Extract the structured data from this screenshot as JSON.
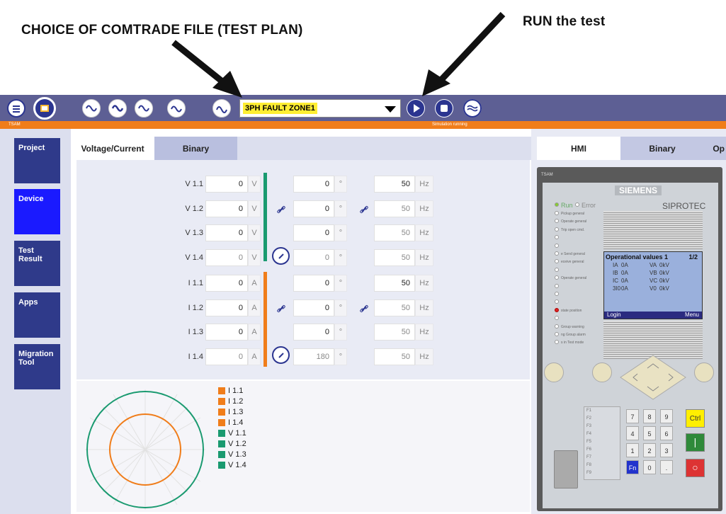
{
  "annotations": {
    "comtrade_note": "CHOICE OF COMTRADE FILE (TEST PLAN)",
    "run_note": "RUN the test"
  },
  "toolbar": {
    "app_label": "TSAM",
    "status": "Simulation running",
    "test_plan_selected": "3PH FAULT ZONE1"
  },
  "nav": [
    "Project",
    "Device",
    "Test Result",
    "Apps",
    "Migration Tool"
  ],
  "tabs": {
    "voltage_current": "Voltage/Current",
    "binary": "Binary"
  },
  "right_tabs": {
    "hmi": "HMI",
    "binary": "Binary",
    "op": "Op"
  },
  "rows": [
    {
      "label": "V 1.1",
      "mag": "0",
      "unit": "V",
      "angle": "0",
      "freq": "50",
      "fu": "Hz"
    },
    {
      "label": "V 1.2",
      "mag": "0",
      "unit": "V",
      "angle": "0",
      "freq": "50",
      "fu": "Hz"
    },
    {
      "label": "V 1.3",
      "mag": "0",
      "unit": "V",
      "angle": "0",
      "freq": "50",
      "fu": "Hz"
    },
    {
      "label": "V 1.4",
      "mag": "0",
      "unit": "V",
      "angle": "0",
      "freq": "50",
      "fu": "Hz"
    },
    {
      "label": "I 1.1",
      "mag": "0",
      "unit": "A",
      "angle": "0",
      "freq": "50",
      "fu": "Hz"
    },
    {
      "label": "I 1.2",
      "mag": "0",
      "unit": "A",
      "angle": "0",
      "freq": "50",
      "fu": "Hz"
    },
    {
      "label": "I 1.3",
      "mag": "0",
      "unit": "A",
      "angle": "0",
      "freq": "50",
      "fu": "Hz"
    },
    {
      "label": "I 1.4",
      "mag": "0",
      "unit": "A",
      "angle": "180",
      "freq": "50",
      "fu": "Hz"
    }
  ],
  "deg": "°",
  "legend": [
    "I 1.1",
    "I 1.2",
    "I 1.3",
    "I 1.4",
    "V 1.1",
    "V 1.2",
    "V 1.3",
    "V 1.4"
  ],
  "colors": {
    "voltage": "#1a9a70",
    "current": "#f07d1a",
    "topbar": "#5d5f94",
    "nav": "#2f3a8a"
  },
  "device": {
    "small_label": "TSAM",
    "brand": "SIEMENS",
    "model": "SIPROTEC",
    "run": "Run",
    "error": "Error",
    "leds": [
      "Pickup general",
      "Operate general",
      "Trip open cmd.",
      "",
      "",
      "e Send general",
      "eceive general",
      "",
      "Operate general",
      "",
      "",
      "",
      "state position",
      "",
      "Group warning",
      "ng Group alarm",
      "s in Test mode"
    ],
    "screen_title": "Operational values 1",
    "screen_page": "1/2",
    "screen_lines": [
      [
        "IA",
        "0A",
        "VA",
        "0kV"
      ],
      [
        "IB",
        "0A",
        "VB",
        "0kV"
      ],
      [
        "IC",
        "0A",
        "VC",
        "0kV"
      ],
      [
        "3I0",
        "0A",
        "V0",
        "0kV"
      ]
    ],
    "login": "Login",
    "menu": "Menu",
    "fkeys": [
      "F1",
      "F2",
      "F3",
      "F4",
      "F5",
      "F6",
      "F7",
      "F8",
      "F9"
    ],
    "keypad": [
      [
        "7",
        "8",
        "9"
      ],
      [
        "4",
        "5",
        "6"
      ],
      [
        "1",
        "2",
        "3"
      ],
      [
        "Fn",
        "0",
        "."
      ]
    ],
    "ctrl": "Ctrl"
  }
}
